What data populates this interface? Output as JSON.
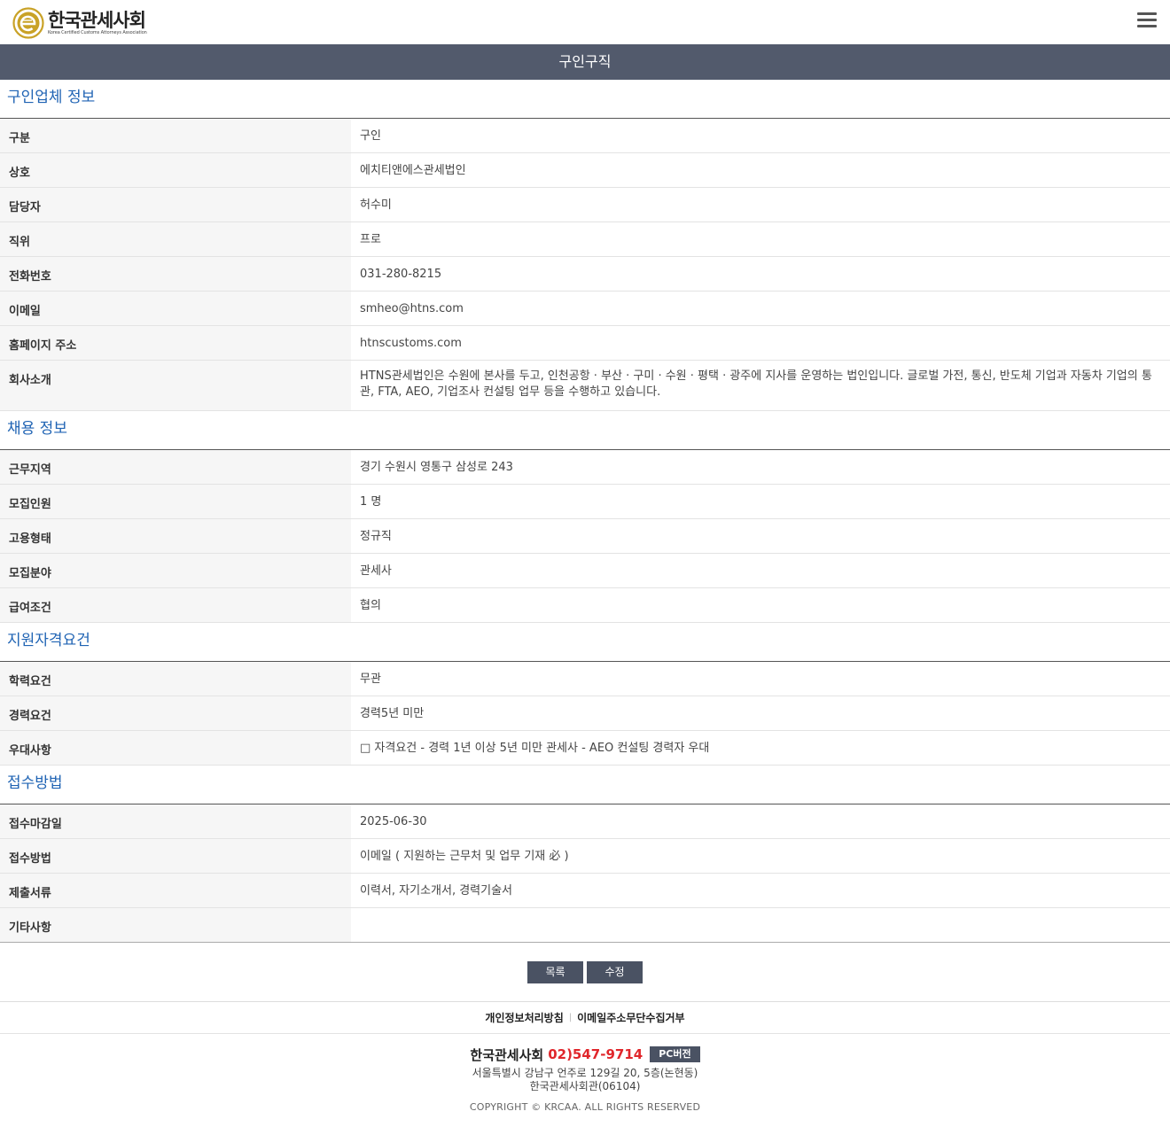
{
  "header": {
    "logo_name": "한국관세사회",
    "logo_sub": "Korea Certified Customs Attorneys Association",
    "menu_icon": "hamburger-menu-icon"
  },
  "page_title": "구인구직",
  "sections": {
    "company": {
      "title": "구인업체 정보",
      "rows": [
        {
          "label": "구분",
          "value": "구인"
        },
        {
          "label": "상호",
          "value": "에치티앤에스관세법인"
        },
        {
          "label": "담당자",
          "value": "허수미"
        },
        {
          "label": "직위",
          "value": "프로"
        },
        {
          "label": "전화번호",
          "value": "031-280-8215"
        },
        {
          "label": "이메일",
          "value": "smheo@htns.com"
        },
        {
          "label": "홈페이지 주소",
          "value": "htnscustoms.com"
        },
        {
          "label": "회사소개",
          "value": "HTNS관세법인은 수원에 본사를 두고, 인천공항 · 부산 · 구미 · 수원 · 평택 · 광주에 지사를 운영하는 법인입니다. 글로벌 가전, 통신, 반도체 기업과 자동차 기업의 통관, FTA, AEO, 기업조사 컨설팅 업무 등을 수행하고 있습니다."
        }
      ]
    },
    "recruit": {
      "title": "채용 정보",
      "rows": [
        {
          "label": "근무지역",
          "value": "경기 수원시 영통구 삼성로 243"
        },
        {
          "label": "모집인원",
          "value": "1 명"
        },
        {
          "label": "고용형태",
          "value": "정규직"
        },
        {
          "label": "모집분야",
          "value": "관세사"
        },
        {
          "label": "급여조건",
          "value": "협의"
        }
      ]
    },
    "qualify": {
      "title": "지원자격요건",
      "rows": [
        {
          "label": "학력요건",
          "value": "무관"
        },
        {
          "label": "경력요건",
          "value": "경력5년 미만"
        },
        {
          "label": "우대사항",
          "value": "□ 자격요건 - 경력 1년 이상 5년 미만 관세사 - AEO 컨설팅 경력자 우대"
        }
      ]
    },
    "apply": {
      "title": "접수방법",
      "rows": [
        {
          "label": "접수마감일",
          "value": "2025-06-30"
        },
        {
          "label": "접수방법",
          "value": "이메일 ( 지원하는 근무처 및 업무 기재 必 )"
        },
        {
          "label": "제출서류",
          "value": "이력서, 자기소개서, 경력기술서"
        },
        {
          "label": "기타사항",
          "value": ""
        }
      ]
    }
  },
  "buttons": {
    "list": "목록",
    "edit": "수정"
  },
  "footer": {
    "links": [
      "개인정보처리방침",
      "이메일주소무단수집거부"
    ],
    "org_name": "한국관세사회",
    "phone": "02)547-9714",
    "pc_button": "PC버전",
    "address_line1": "서울특별시 강남구 언주로 129길 20, 5층(논현동)",
    "address_line2": "한국관세사회관(06104)",
    "copyright": "COPYRIGHT © KRCAA. ALL RIGHTS RESERVED"
  },
  "colors": {
    "title_bar": "#525a6c",
    "section_title": "#2064b4",
    "button": "#4a5263",
    "phone": "#e0262b",
    "logo_gold": "#c9a227"
  }
}
